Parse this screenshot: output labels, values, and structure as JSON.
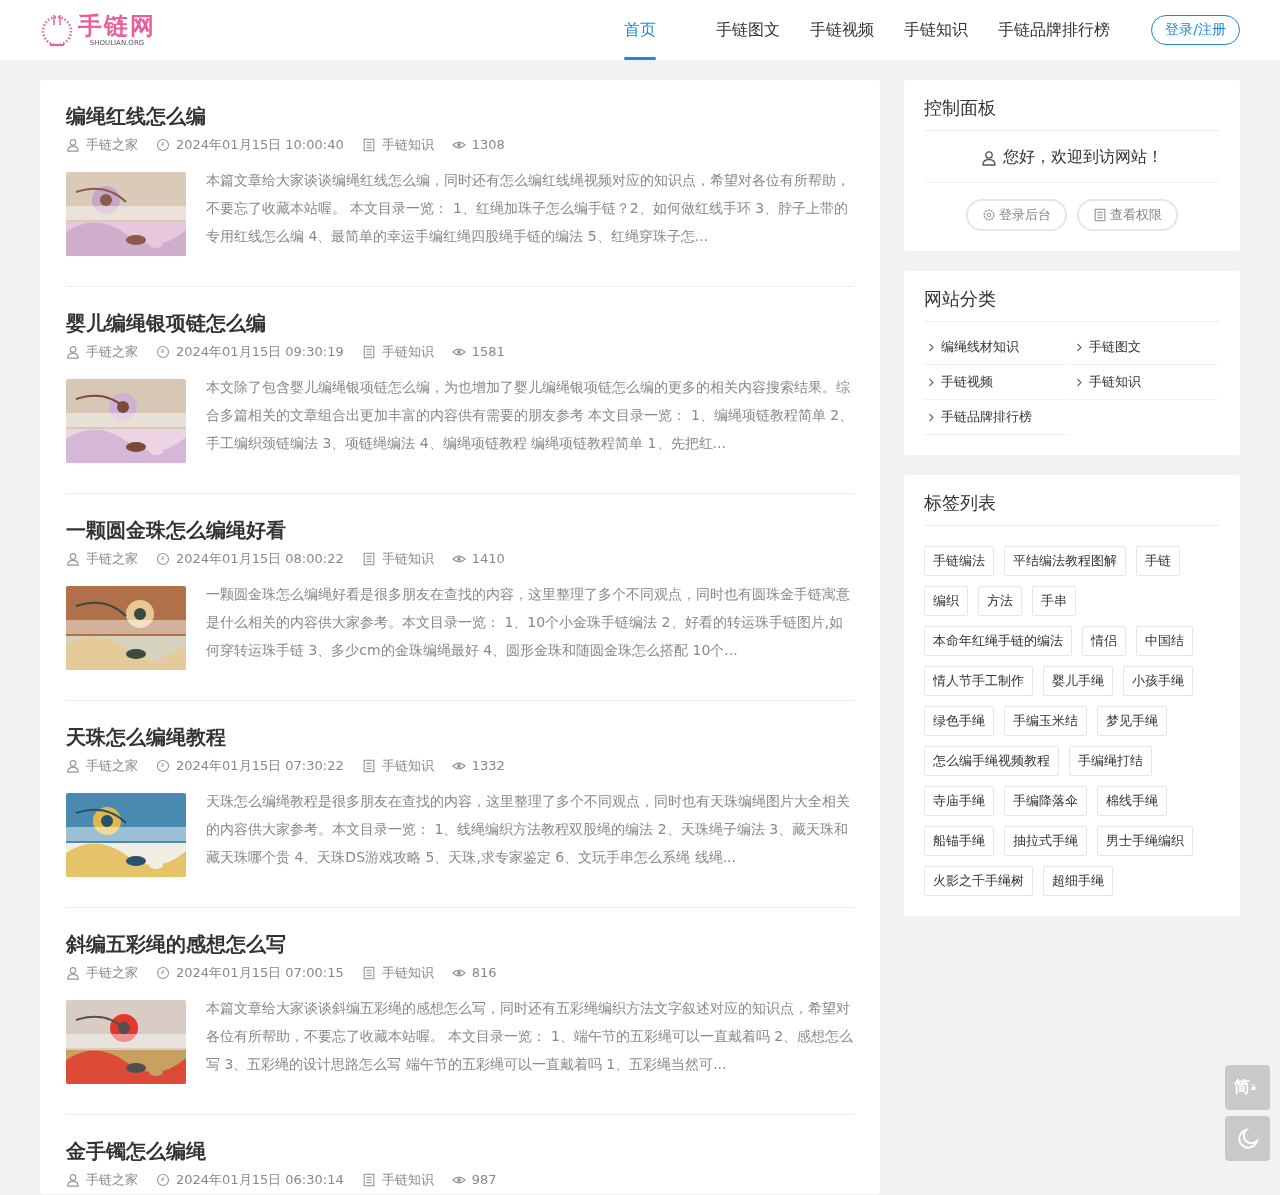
{
  "logo": {
    "name": "手链网",
    "domain": "SHOULIAN.ORG"
  },
  "nav": [
    {
      "label": "首页",
      "selected": true
    },
    {
      "label": "手链图文",
      "selected": false
    },
    {
      "label": "手链视频",
      "selected": false
    },
    {
      "label": "手链知识",
      "selected": false
    },
    {
      "label": "手链品牌排行榜",
      "selected": false
    }
  ],
  "login_button": "登录/注册",
  "articles": [
    {
      "title": "编绳红线怎么编",
      "author": "手链之家",
      "date": "2024年01月15日 10:00:40",
      "category": "手链知识",
      "views": "1308",
      "excerpt": "本篇文章给大家谈谈编绳红线怎么编，同时还有怎么编红线绳视频对应的知识点，希望对各位有所帮助，不要忘了收藏本站喔。 本文目录一览： 1、红绳加珠子怎么编手链？2、如何做红线手环 3、脖子上带的专用红线怎么编 4、最简单的幸运手编红绳四股绳手链的编法 5、红绳穿珠子怎..."
    },
    {
      "title": "婴儿编绳银项链怎么编",
      "author": "手链之家",
      "date": "2024年01月15日 09:30:19",
      "category": "手链知识",
      "views": "1581",
      "excerpt": "本文除了包含婴儿编绳银项链怎么编，为也增加了婴儿编绳银项链怎么编的更多的相关内容搜索结果。综合多篇相关的文章组合出更加丰富的内容供有需要的朋友参考 本文目录一览： 1、编绳项链教程简单 2、手工编织颈链编法 3、项链绳编法 4、编绳项链教程 编绳项链教程简单 1、先把红..."
    },
    {
      "title": "一颗圆金珠怎么编绳好看",
      "author": "手链之家",
      "date": "2024年01月15日 08:00:22",
      "category": "手链知识",
      "views": "1410",
      "excerpt": "一颗圆金珠怎么编绳好看是很多朋友在查找的内容，这里整理了多个不同观点，同时也有圆珠金手链寓意是什么相关的内容供大家参考。本文目录一览： 1、10个小金珠手链编法 2、好看的转运珠手链图片,如何穿转运珠手链 3、多少cm的金珠编绳最好 4、圆形金珠和随圆金珠怎么搭配 10个..."
    },
    {
      "title": "天珠怎么编绳教程",
      "author": "手链之家",
      "date": "2024年01月15日 07:30:22",
      "category": "手链知识",
      "views": "1332",
      "excerpt": "天珠怎么编绳教程是很多朋友在查找的内容，这里整理了多个不同观点，同时也有天珠编绳图片大全相关的内容供大家参考。本文目录一览： 1、线绳编织方法教程双股绳的编法 2、天珠绳子编法 3、藏天珠和藏天珠哪个贵 4、天珠DS游戏攻略 5、天珠,求专家鉴定 6、文玩手串怎么系绳 线绳..."
    },
    {
      "title": "斜编五彩绳的感想怎么写",
      "author": "手链之家",
      "date": "2024年01月15日 07:00:15",
      "category": "手链知识",
      "views": "816",
      "excerpt": "本篇文章给大家谈谈斜编五彩绳的感想怎么写，同时还有五彩绳编织方法文字叙述对应的知识点，希望对各位有所帮助，不要忘了收藏本站喔。 本文目录一览： 1、端午节的五彩绳可以一直戴着吗 2、感想怎么写 3、五彩绳的设计思路怎么写 端午节的五彩绳可以一直戴着吗 1、五彩绳当然可..."
    },
    {
      "title": "金手镯怎么编绳",
      "author": "手链之家",
      "date": "2024年01月15日 06:30:14",
      "category": "手链知识",
      "views": "987"
    }
  ],
  "control_panel": {
    "title": "控制面板",
    "welcome": "您好，欢迎到访网站！",
    "buttons": [
      "登录后台",
      "查看权限"
    ]
  },
  "categories": {
    "title": "网站分类",
    "items": [
      "编绳线材知识",
      "手链图文",
      "手链视频",
      "手链知识",
      "手链品牌排行榜"
    ]
  },
  "tags": {
    "title": "标签列表",
    "items": [
      "手链编法",
      "平结编法教程图解",
      "手链",
      "编织",
      "方法",
      "手串",
      "本命年红绳手链的编法",
      "情侣",
      "中国结",
      "情人节手工制作",
      "婴儿手绳",
      "小孩手绳",
      "绿色手绳",
      "手编玉米结",
      "梦见手绳",
      "怎么编手绳视频教程",
      "手编绳打结",
      "寺庙手绳",
      "手编降落伞",
      "棉线手绳",
      "船锚手绳",
      "抽拉式手绳",
      "男士手绳编织",
      "火影之千手绳树",
      "超细手绳"
    ]
  },
  "float_buttons": {
    "language": "简"
  }
}
